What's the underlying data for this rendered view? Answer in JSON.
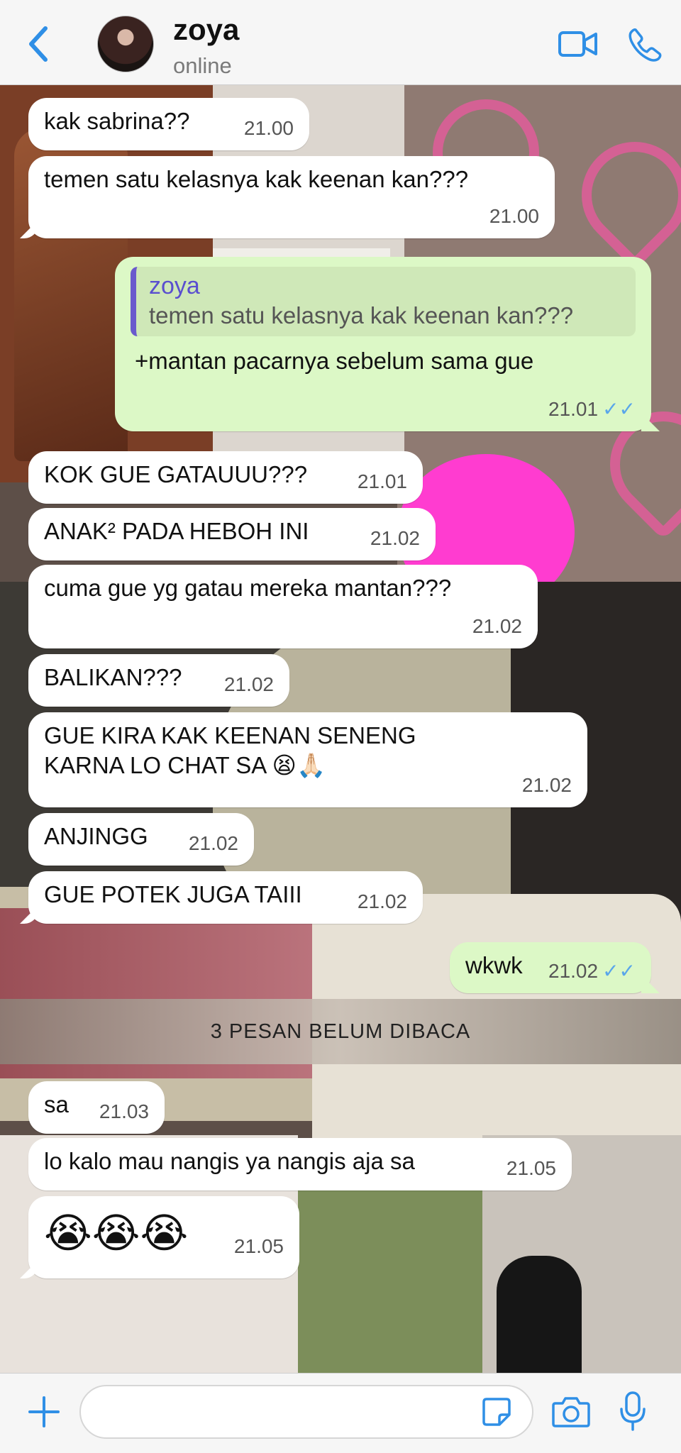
{
  "header": {
    "contact_name": "zoya",
    "status": "online"
  },
  "accent_color": "#2f8fe6",
  "icons": {
    "back": "chevron-left-icon",
    "video": "video-camera-icon",
    "phone": "phone-icon",
    "attach": "plus-icon",
    "sticker": "sticker-icon",
    "camera": "camera-icon",
    "mic": "microphone-icon"
  },
  "messages": [
    {
      "dir": "in",
      "text": "kak sabrina??",
      "time": "21.00"
    },
    {
      "dir": "in",
      "text": "temen satu kelasnya kak keenan kan???",
      "time": "21.00"
    },
    {
      "dir": "out",
      "quote_author": "zoya",
      "quote_text": "temen satu kelasnya kak keenan kan???",
      "text": "+mantan pacarnya sebelum sama gue",
      "time": "21.01",
      "status": "read"
    },
    {
      "dir": "in",
      "text": "KOK GUE GATAUUU???",
      "time": "21.01"
    },
    {
      "dir": "in",
      "text": "ANAK² PADA HEBOH INI",
      "time": "21.02"
    },
    {
      "dir": "in",
      "text": "cuma gue yg gatau mereka mantan???",
      "time": "21.02"
    },
    {
      "dir": "in",
      "text": "BALIKAN???",
      "time": "21.02"
    },
    {
      "dir": "in",
      "text": "GUE KIRA KAK KEENAN SENENG KARNA LO CHAT SA 😫🙏🏻",
      "time": "21.02"
    },
    {
      "dir": "in",
      "text": "ANJINGG",
      "time": "21.02"
    },
    {
      "dir": "in",
      "text": "GUE POTEK JUGA TAIII",
      "time": "21.02"
    },
    {
      "dir": "out",
      "text": "wkwk",
      "time": "21.02",
      "status": "read"
    },
    {
      "dir": "in",
      "text": "sa",
      "time": "21.03"
    },
    {
      "dir": "in",
      "text": "lo kalo mau nangis ya nangis aja sa",
      "time": "21.05"
    },
    {
      "dir": "in",
      "text": "😭😭😭",
      "time": "21.05"
    }
  ],
  "unread_divider": "3 PESAN BELUM DIBACA",
  "composer": {
    "value": "",
    "placeholder": ""
  },
  "read_ticks": "✓✓"
}
